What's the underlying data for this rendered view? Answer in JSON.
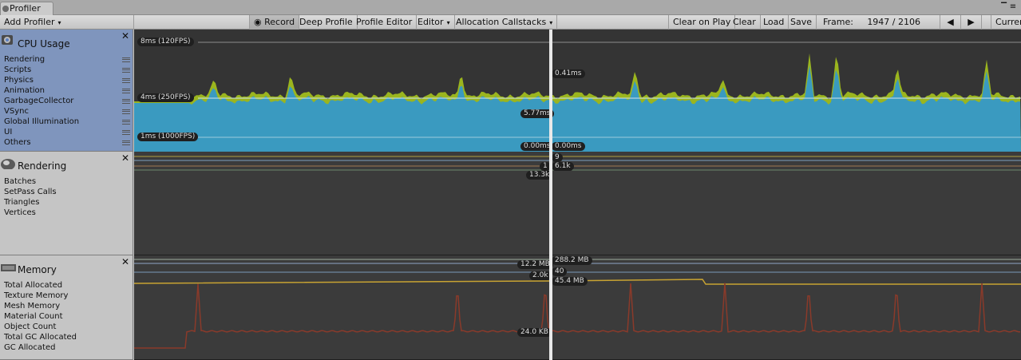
{
  "window": {
    "tab_title": "Profiler",
    "menu_icon": "menu-icon",
    "maximize_icon": "maximize-icon"
  },
  "toolbar": {
    "add_profiler": "Add Profiler",
    "record": "Record",
    "deep_profile": "Deep Profile",
    "profile_editor": "Profile Editor",
    "editor": "Editor",
    "allocation_callstacks": "Allocation Callstacks",
    "clear_on_play": "Clear on Play",
    "clear": "Clear",
    "load": "Load",
    "save": "Save",
    "frame_label": "Frame:",
    "frame_value": "1947 / 2106",
    "current": "Current"
  },
  "panels": {
    "cpu": {
      "title": "CPU Usage",
      "items": [
        "Rendering",
        "Scripts",
        "Physics",
        "Animation",
        "GarbageCollector",
        "VSync",
        "Global Illumination",
        "UI",
        "Others"
      ],
      "lines": [
        "8ms (120FPS)",
        "4ms (250FPS)",
        "1ms (1000FPS)"
      ],
      "readouts": {
        "top": "0.41ms",
        "mid": "5.77ms",
        "left_bottom": "0.00ms",
        "right_bottom": "0.00ms"
      }
    },
    "rendering": {
      "title": "Rendering",
      "items": [
        "Batches",
        "SetPass Calls",
        "Triangles",
        "Vertices"
      ],
      "readouts": {
        "batches": "9",
        "setpass": "1",
        "triangles": "6.1k",
        "vertices": "13.3k"
      }
    },
    "memory": {
      "title": "Memory",
      "items": [
        "Total Allocated",
        "Texture Memory",
        "Mesh Memory",
        "Material Count",
        "Object Count",
        "Total GC Allocated",
        "GC Allocated"
      ],
      "readouts": {
        "total_allocated": "288.2 MB",
        "texture_memory": "12.2 MB",
        "material_count": "40",
        "object_count": "2.0k",
        "total_gc": "45.4 MB",
        "gc_allocated": "24.0 KB"
      }
    }
  },
  "colors": {
    "cpu_rendering": "#9bb51e",
    "cpu_scripts": "#3a9ac0",
    "cpu_panel_bg": "#7f95bd",
    "gc_line": "#8a3a2a",
    "total_gc_line": "#c8a332"
  }
}
